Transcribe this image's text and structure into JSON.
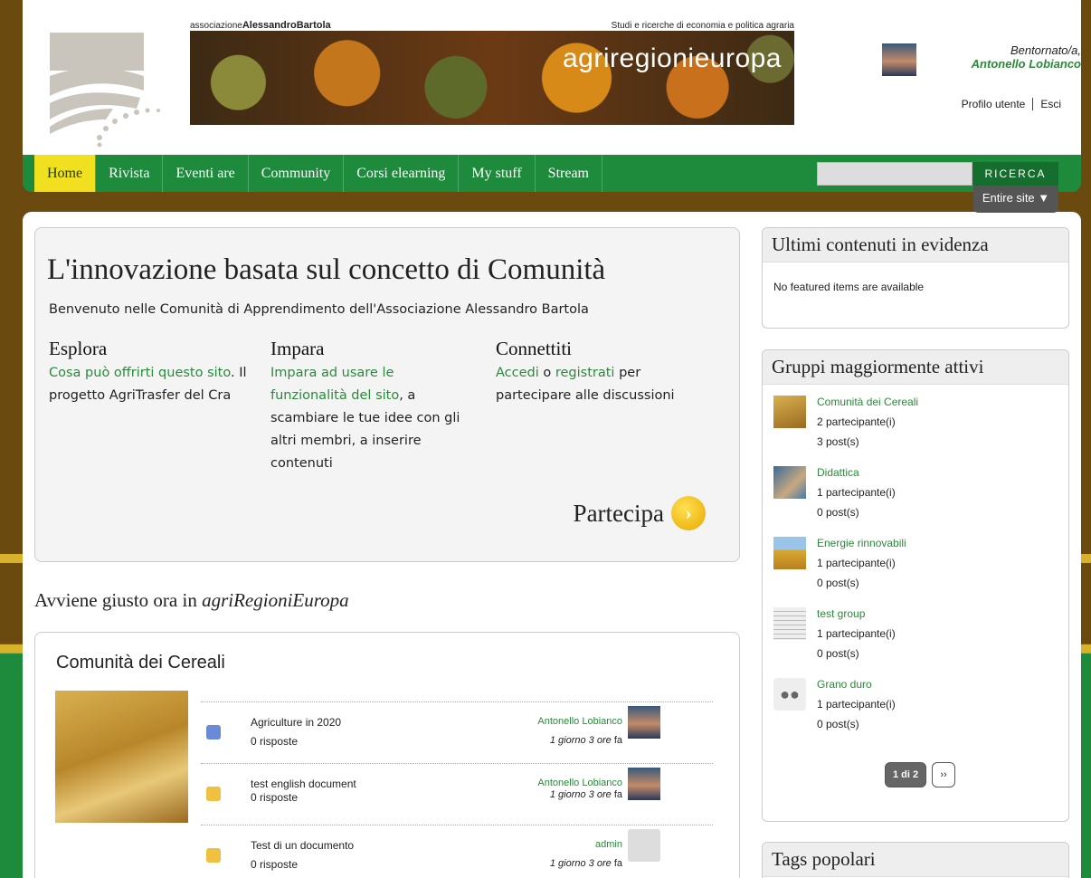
{
  "header": {
    "assoc_prefix": "associazione",
    "assoc_name": "AlessandroBartola",
    "tagline": "Studi e ricerche di economia e politica agraria",
    "brand": "agriregionieuropa",
    "welcome": "Bentornato/a,",
    "user_name": "Antonello Lobianco",
    "profile_link": "Profilo utente",
    "logout_link": "Esci"
  },
  "nav": {
    "items": [
      "Home",
      "Rivista",
      "Eventi are",
      "Community",
      "Corsi elearning",
      "My stuff",
      "Stream"
    ],
    "search_button": "RICERCA",
    "search_scope": "Entire site ▼"
  },
  "hero": {
    "title": "L'innovazione basata sul concetto di Comunità",
    "intro": "Benvenuto nelle Comunità di Apprendimento dell'Associazione Alessandro Bartola",
    "explore": {
      "title": "Esplora",
      "link": "Cosa può offrirti questo sito",
      "text": ". Il progetto AgriTrasfer del Cra"
    },
    "learn": {
      "title": "Impara",
      "link": "Impara ad usare le funzionalità del sito",
      "text": ", a scambiare le tue idee con gli altri membri, a inserire contenuti"
    },
    "connect": {
      "title": "Connettiti",
      "link1": "Accedi",
      "mid": " o ",
      "link2": "registrati",
      "text": " per partecipare alle discussioni"
    },
    "cta": "Partecipa"
  },
  "now": {
    "prefix": "Avviene giusto ora in ",
    "site": "agriRegioniEuropa"
  },
  "group_card": {
    "title": "Comunità dei Cereali",
    "posts": [
      {
        "title": "Agriculture in 2020",
        "replies": "0 risposte",
        "author": "Antonello Lobianco",
        "when": "1 giorno 3 ore",
        "ago": " fa",
        "icon": "discussion-icon"
      },
      {
        "title": "test english document",
        "replies": "0 risposte",
        "author": "Antonello Lobianco",
        "when": "1 giorno 3 ore",
        "ago": " fa",
        "icon": "document-icon"
      },
      {
        "title": "Test di un documento",
        "replies": "0 risposte",
        "author": "admin",
        "when": "1 giorno 3 ore",
        "ago": " fa",
        "icon": "document-icon"
      }
    ]
  },
  "sidebar": {
    "featured_title": "Ultimi contenuti in evidenza",
    "featured_empty": "No featured items are available",
    "groups_title": "Gruppi maggiormente attivi",
    "groups": [
      {
        "name": "Comunità dei Cereali",
        "members": "2 partecipante(i)",
        "posts": "3 post(s)"
      },
      {
        "name": "Didattica",
        "members": "1 partecipante(i)",
        "posts": "0 post(s)"
      },
      {
        "name": "Energie rinnovabili",
        "members": "1 partecipante(i)",
        "posts": "0 post(s)"
      },
      {
        "name": "test group",
        "members": "1 partecipante(i)",
        "posts": "0 post(s)"
      },
      {
        "name": "Grano duro",
        "members": "1 partecipante(i)",
        "posts": "0 post(s)"
      }
    ],
    "pager": "1 di 2",
    "pager_next": "››",
    "tags_title": "Tags popolari"
  }
}
